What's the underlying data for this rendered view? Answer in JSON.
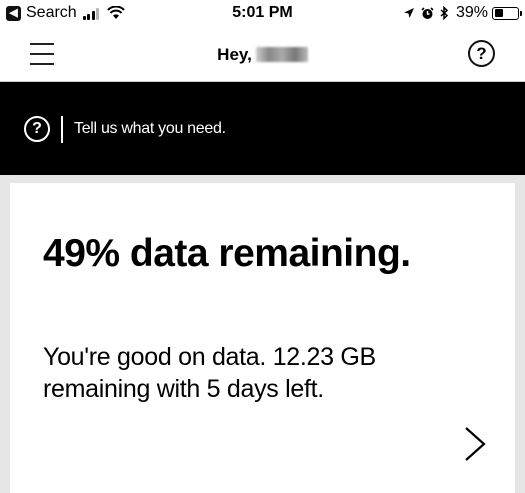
{
  "status_bar": {
    "back_app": "Search",
    "time": "5:01 PM",
    "battery_percent": "39%",
    "battery_level": 0.39,
    "icons": [
      "back-arrow-badge",
      "cellular-signal",
      "wifi",
      "location-arrow",
      "alarm-clock",
      "bluetooth",
      "battery"
    ]
  },
  "header": {
    "greeting": "Hey,",
    "menu_icon": "hamburger-menu-icon",
    "help_icon": "question-circle-icon"
  },
  "banner": {
    "text": "Tell us what you need.",
    "icon": "question-circle-icon"
  },
  "card": {
    "title": "49% data remaining.",
    "description": "You're good on data. 12.23 GB remaining with 5 days left.",
    "data_remaining_percent": 49,
    "chevron_icon": "chevron-right-icon"
  },
  "colors": {
    "banner_bg": "#000000",
    "page_bg": "#e6e6e6",
    "card_bg": "#ffffff"
  }
}
